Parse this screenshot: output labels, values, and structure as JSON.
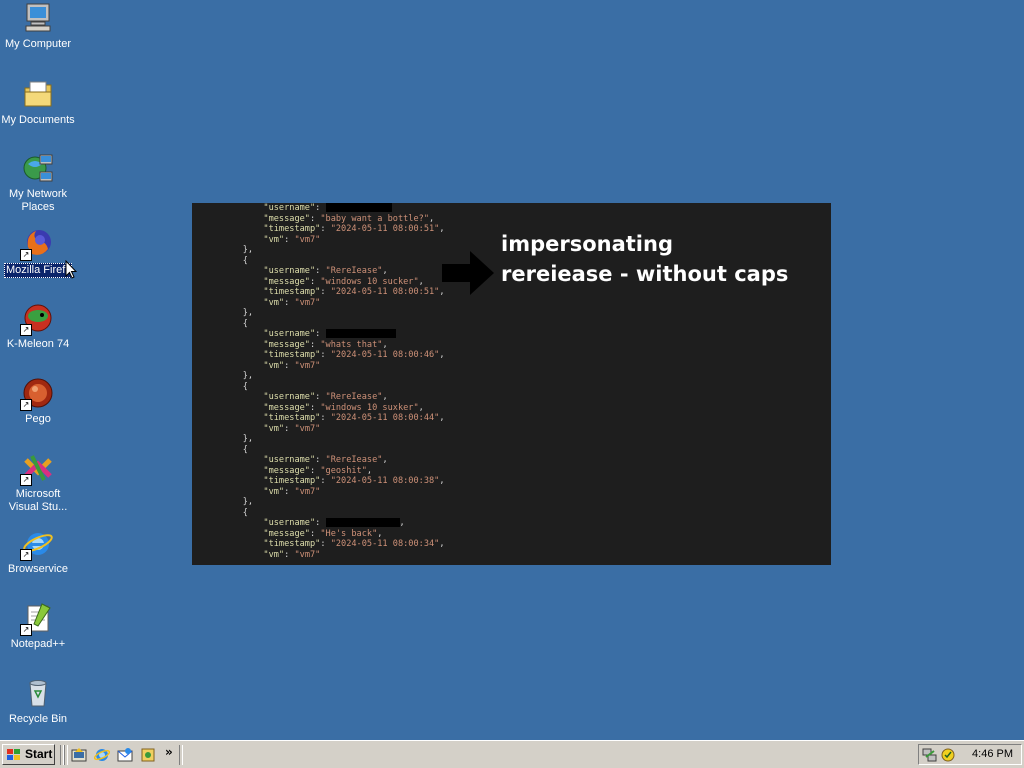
{
  "desktop": {
    "background_color": "#3a6ea5",
    "icons": [
      {
        "label": "My Computer",
        "icon": "my-computer-icon"
      },
      {
        "label": "My Documents",
        "icon": "my-documents-icon"
      },
      {
        "label_line1": "My Network",
        "label_line2": "Places",
        "icon": "network-places-icon"
      },
      {
        "label": "Mozilla Firefox",
        "icon": "firefox-icon"
      },
      {
        "label": "K-Meleon 74",
        "icon": "k-meleon-icon"
      },
      {
        "label": "Pego",
        "icon": "pego-icon"
      },
      {
        "label_line1": "Microsoft",
        "label_line2": "Visual Stu...",
        "icon": "visual-studio-icon"
      },
      {
        "label": "Browservice",
        "icon": "internet-explorer-icon"
      },
      {
        "label": "Notepad++",
        "icon": "notepad-plus-plus-icon"
      },
      {
        "label": "Recycle Bin",
        "icon": "recycle-bin-icon"
      }
    ]
  },
  "code_image": {
    "annotation_line1": "impersonating",
    "annotation_line2": "rereiease - without caps",
    "entries": [
      {
        "username": "",
        "message": "\"baby want a bottle?\"",
        "timestamp": "\"2024-05-11 08:00:51\"",
        "vm": "\"vm7\"",
        "redacted": true
      },
      {
        "username": "\"RereIease\"",
        "message": "\"windows 10 sucker\"",
        "timestamp": "\"2024-05-11 08:00:51\"",
        "vm": "\"vm7\"",
        "redacted": false
      },
      {
        "username": "",
        "message": "\"whats that\"",
        "timestamp": "\"2024-05-11 08:00:46\"",
        "vm": "\"vm7\"",
        "redacted": true
      },
      {
        "username": "\"RereIease\"",
        "message": "\"windows 10 suxker\"",
        "timestamp": "\"2024-05-11 08:00:44\"",
        "vm": "\"vm7\"",
        "redacted": false
      },
      {
        "username": "\"RereIease\"",
        "message": "\"geoshit\"",
        "timestamp": "\"2024-05-11 08:00:38\"",
        "vm": "\"vm7\"",
        "redacted": false
      },
      {
        "username": "",
        "message": "\"He's back\"",
        "timestamp": "\"2024-05-11 08:00:34\"",
        "vm": "\"vm7\"",
        "redacted": true
      }
    ],
    "keys": {
      "username": "\"username\"",
      "message": "\"message\"",
      "timestamp": "\"timestamp\"",
      "vm": "\"vm\""
    }
  },
  "taskbar": {
    "start_label": "Start",
    "chevron": "»",
    "clock": "4:46 PM",
    "quick_launch": [
      "show-desktop-icon",
      "internet-explorer-icon",
      "outlook-express-icon",
      "media-icon"
    ]
  }
}
